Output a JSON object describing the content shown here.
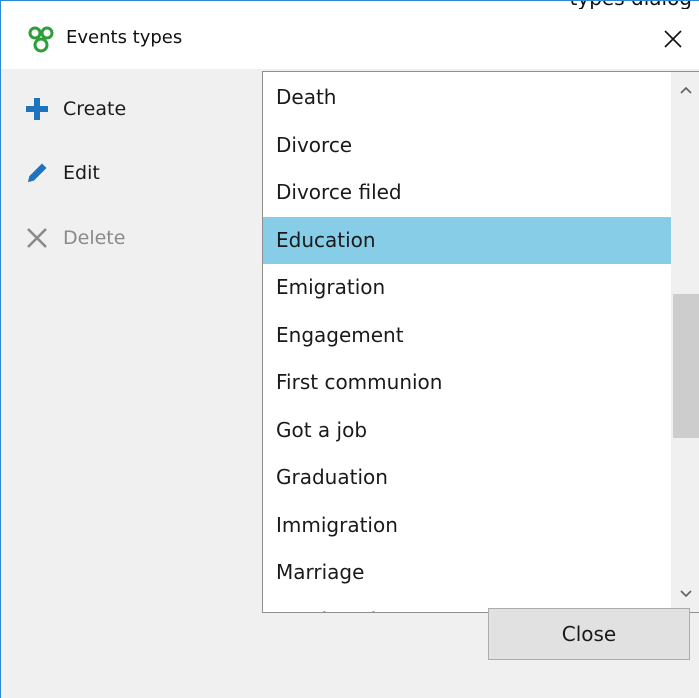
{
  "window": {
    "title": "Events types",
    "behind_title_fragment": "types dialog",
    "accent": "#2b8ad6"
  },
  "toolbar": {
    "create_label": "Create",
    "edit_label": "Edit",
    "delete_label": "Delete",
    "create_icon": "plus-icon",
    "edit_icon": "pencil-icon",
    "delete_icon": "x-icon",
    "create_color": "#1e73be",
    "edit_color": "#1e73be",
    "delete_color": "#8a8a8a"
  },
  "list": {
    "items": [
      "Death",
      "Divorce",
      "Divorce filed",
      "Education",
      "Emigration",
      "Engagement",
      "First communion",
      "Got a job",
      "Graduation",
      "Immigration",
      "Marriage",
      "Marriage banns"
    ],
    "selected": "Education",
    "selected_color": "#87cde8"
  },
  "footer": {
    "close_label": "Close"
  }
}
